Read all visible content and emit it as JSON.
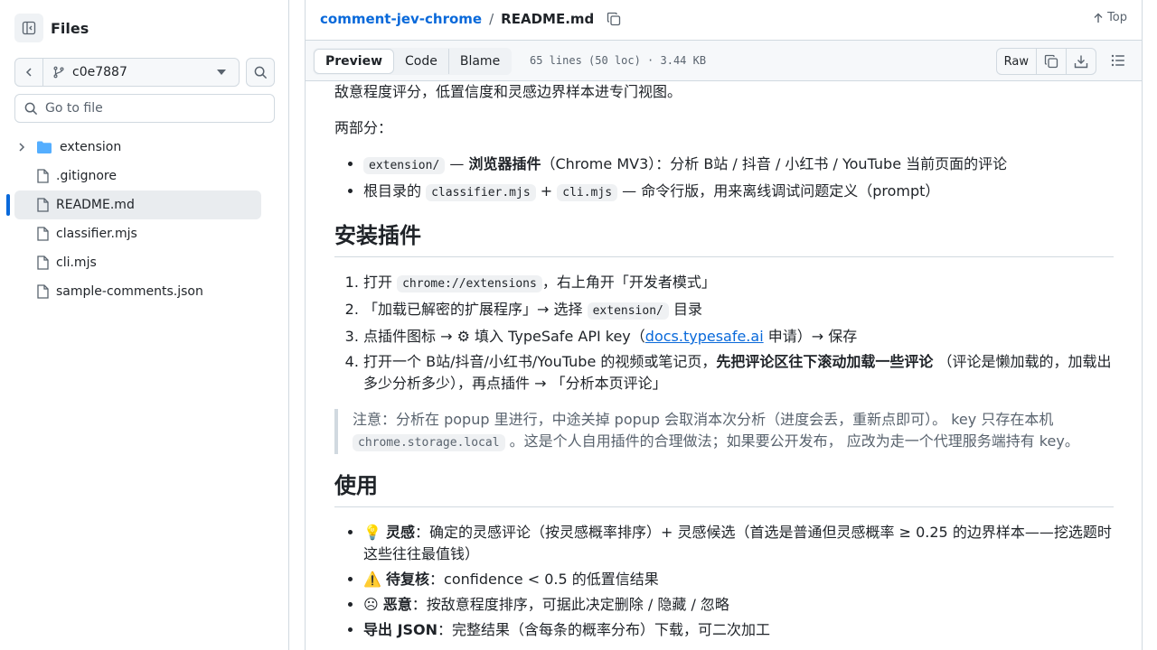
{
  "sidebar": {
    "title": "Files",
    "branch": "c0e7887",
    "goto_placeholder": "Go to file",
    "items": [
      {
        "label": "extension"
      },
      {
        "label": ".gitignore"
      },
      {
        "label": "README.md"
      },
      {
        "label": "classifier.mjs"
      },
      {
        "label": "cli.mjs"
      },
      {
        "label": "sample-comments.json"
      }
    ]
  },
  "header": {
    "repo": "comment-jev-chrome",
    "separator": "/",
    "file": "README.md",
    "top_label": "Top"
  },
  "toolbar": {
    "tabs": [
      "Preview",
      "Code",
      "Blame"
    ],
    "file_info": "65 lines (50 loc) · 3.44 KB",
    "raw_label": "Raw"
  },
  "content": {
    "intro": "敌意程度评分，低置信度和灵感边界样本进专门视图。",
    "parts_label": "两部分：",
    "parts": {
      "p1_code": "extension/",
      "p1_dash": " — ",
      "p1_bold": "浏览器插件",
      "p1_rest": "（Chrome MV3）：分析 B站 / 抖音 / 小红书 / YouTube 当前页面的评论",
      "p2_pre": "根目录的 ",
      "p2_code1": "classifier.mjs",
      "p2_plus": " + ",
      "p2_code2": "cli.mjs",
      "p2_rest": " — 命令行版，用来离线调试问题定义（prompt）"
    },
    "install_heading": "安装插件",
    "install": {
      "s1_pre": "打开 ",
      "s1_code": "chrome://extensions",
      "s1_rest": "，右上角开「开发者模式」",
      "s2_pre": "「加载已解密的扩展程序」→ 选择 ",
      "s2_code": "extension/",
      "s2_rest": " 目录",
      "s3_pre": "点插件图标 → ⚙ 填入 TypeSafe API key（",
      "s3_link": "docs.typesafe.ai",
      "s3_rest": " 申请）→ 保存",
      "s4_pre": "打开一个 B站/抖音/小红书/YouTube 的视频或笔记页，",
      "s4_bold": "先把评论区往下滚动加载一些评论",
      "s4_rest": " （评论是懒加载的，加载出多少分析多少），再点插件 → 「分析本页评论」"
    },
    "note": {
      "pre": "注意：分析在 popup 里进行，中途关掉 popup 会取消本次分析（进度会丢，重新点即可）。 key 只存在本机 ",
      "code": "chrome.storage.local",
      "rest": " 。这是个人自用插件的合理做法；如果要公开发布， 应改为走一个代理服务端持有 key。"
    },
    "usage_heading": "使用",
    "usage": {
      "u1_icon": "💡",
      "u1_bold": "灵感",
      "u1_rest": "：确定的灵感评论（按灵感概率排序）+ 灵感候选（首选是普通但灵感概率 ≥ 0.25 的边界样本——挖选题时这些往往最值钱）",
      "u2_icon": "⚠️",
      "u2_bold": "待复核",
      "u2_rest": "：confidence < 0.5 的低置信结果",
      "u3_icon": "☹",
      "u3_bold": "恶意",
      "u3_rest": "：按敌意程度排序，可据此决定删除 / 隐藏 / 忽略",
      "u4_bold": "导出 JSON",
      "u4_rest": "：完整结果（含每条的概率分布）下载，可二次加工"
    }
  }
}
